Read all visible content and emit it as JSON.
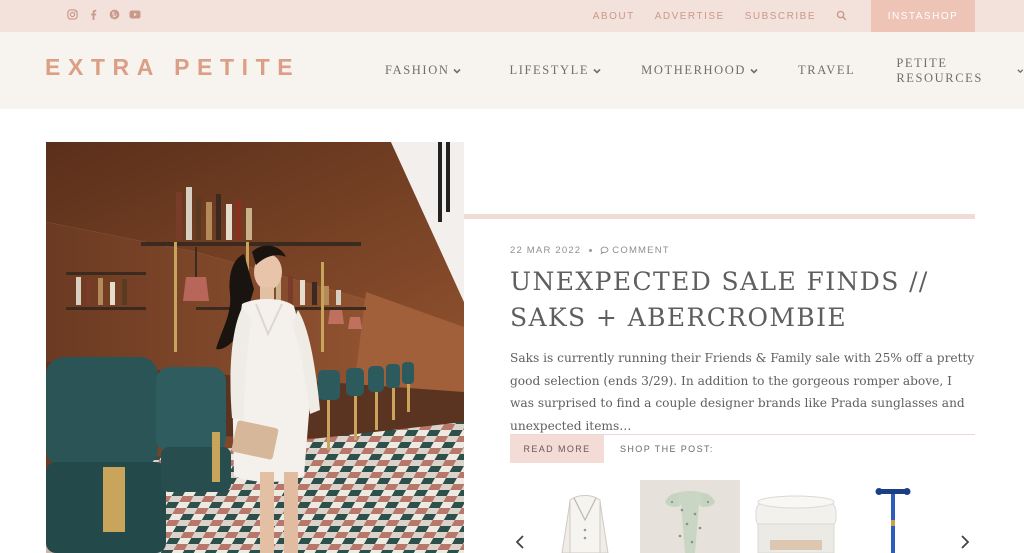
{
  "topbar": {
    "social_icons": [
      "instagram-icon",
      "facebook-icon",
      "pinterest-icon",
      "youtube-icon"
    ],
    "links": [
      "ABOUT",
      "ADVERTISE",
      "SUBSCRIBE"
    ],
    "instashop": "INSTASHOP"
  },
  "header": {
    "logo": "EXTRA PETITE",
    "nav": [
      {
        "label": "FASHION",
        "has_dropdown": true
      },
      {
        "label": "LIFESTYLE",
        "has_dropdown": true
      },
      {
        "label": "MOTHERHOOD",
        "has_dropdown": true
      },
      {
        "label": "TRAVEL",
        "has_dropdown": false
      },
      {
        "label": "PETITE RESOURCES",
        "has_dropdown": true
      }
    ]
  },
  "post": {
    "date": "22 MAR 2022",
    "comment_label": "COMMENT",
    "title": "UNEXPECTED SALE FINDS // SAKS + ABERCROMBIE",
    "excerpt": "Saks is currently running their Friends & Family sale with 25% off a pretty good selection (ends 3/29). In addition to the gorgeous romper above, I was surprised to find a couple designer brands like Prada sunglasses and unexpected items…",
    "read_more": "READ MORE",
    "shop_label": "SHOP THE POST:"
  },
  "colors": {
    "accent": "#dc9f85",
    "topbar_bg": "#f3e1dc",
    "header_bg": "#f7f4ef",
    "button_bg": "#f2dcd5",
    "instashop_bg": "#eec4b6"
  }
}
